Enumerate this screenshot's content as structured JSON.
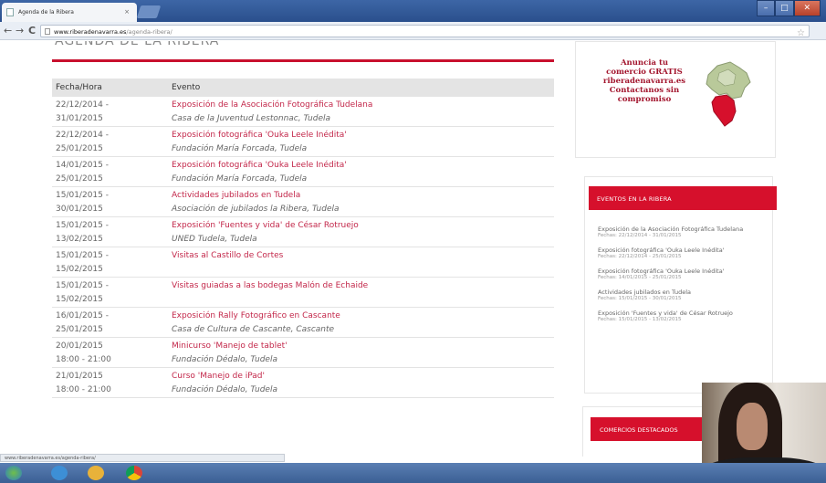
{
  "browser": {
    "tab_title": "Agenda de la Ribera",
    "tab_close": "×",
    "url_host": "www.riberadenavarra.es",
    "url_path": "/agenda-ribera/",
    "nav_back": "←",
    "nav_forward": "→",
    "nav_reload": "C",
    "star": "☆"
  },
  "page": {
    "cut_heading": "AGENDA DE LA RIBERA",
    "table": {
      "col_date": "Fecha/Hora",
      "col_event": "Evento",
      "rows": [
        {
          "date1": "22/12/2014 -",
          "date2": "31/01/2015",
          "title": "Exposición de la Asociación Fotográfica Tudelana",
          "place": "Casa de la Juventud Lestonnac, Tudela"
        },
        {
          "date1": "22/12/2014 -",
          "date2": "25/01/2015",
          "title": "Exposición fotográfica 'Ouka Leele Inédita'",
          "place": "Fundación María Forcada, Tudela"
        },
        {
          "date1": "14/01/2015 -",
          "date2": "25/01/2015",
          "title": "Exposición fotográfica 'Ouka Leele Inédita'",
          "place": "Fundación María Forcada, Tudela"
        },
        {
          "date1": "15/01/2015 -",
          "date2": "30/01/2015",
          "title": "Actividades jubilados en Tudela",
          "place": "Asociación de jubilados la Ribera, Tudela"
        },
        {
          "date1": "15/01/2015 -",
          "date2": "13/02/2015",
          "title": "Exposición 'Fuentes y vida' de César Rotruejo",
          "place": "UNED Tudela, Tudela"
        },
        {
          "date1": "15/01/2015 -",
          "date2": "15/02/2015",
          "title": "Visitas al Castillo de Cortes",
          "place": ""
        },
        {
          "date1": "15/01/2015 -",
          "date2": "15/02/2015",
          "title": "Visitas guiadas a las bodegas Malón de Echaide",
          "place": ""
        },
        {
          "date1": "16/01/2015 -",
          "date2": "25/01/2015",
          "title": "Exposición Rally Fotográfico en Cascante",
          "place": "Casa de Cultura de Cascante, Cascante"
        },
        {
          "date1": "20/01/2015",
          "date2": "18:00 - 21:00",
          "title": "Minicurso 'Manejo de tablet'",
          "place": "Fundación Dédalo, Tudela"
        },
        {
          "date1": "21/01/2015",
          "date2": "18:00 - 21:00",
          "title": "Curso 'Manejo de iPad'",
          "place": "Fundación Dédalo, Tudela"
        }
      ]
    }
  },
  "sidebar": {
    "ad_lines": [
      "Anuncia tu",
      "comercio GRATIS",
      "riberadenavarra.es",
      "Contactanos sin",
      "compromiso"
    ],
    "events_widget": {
      "heading": "EVENTOS EN LA RIBERA",
      "items": [
        {
          "title": "Exposición de la Asociación Fotográfica Tudelana",
          "date": "Fechas: 22/12/2014 - 31/01/2015"
        },
        {
          "title": "Exposición fotográfica 'Ouka Leele Inédita'",
          "date": "Fechas: 22/12/2014 - 25/01/2015"
        },
        {
          "title": "Exposición fotográfica 'Ouka Leele Inédita'",
          "date": "Fechas: 14/01/2015 - 25/01/2015"
        },
        {
          "title": "Actividades jubilados en Tudela",
          "date": "Fechas: 15/01/2015 - 30/01/2015"
        },
        {
          "title": "Exposición 'Fuentes y vida' de César Rotruejo",
          "date": "Fechas: 15/01/2015 - 13/02/2015"
        }
      ]
    },
    "shops_widget": {
      "heading": "COMERCIOS DESTACADOS"
    }
  },
  "statusbar": {
    "text": "www.riberadenavarra.es/agenda-ribera/"
  },
  "colors": {
    "accent_red": "#d6102c",
    "link_red": "#c3274a"
  }
}
